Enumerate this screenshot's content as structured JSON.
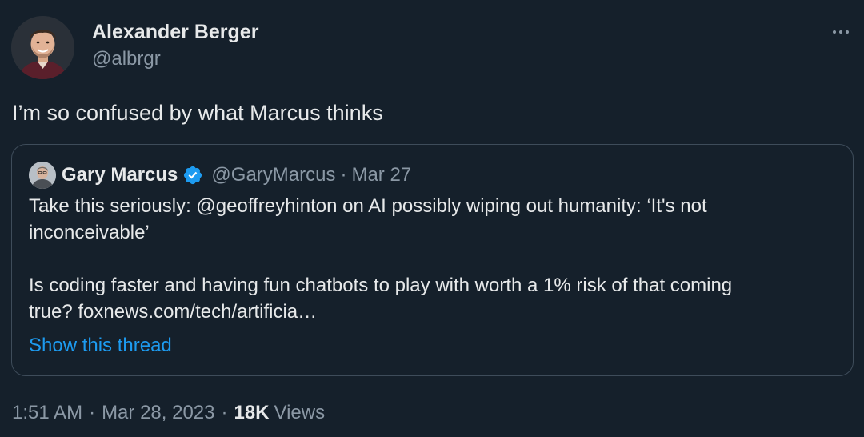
{
  "tweet": {
    "author": {
      "name": "Alexander Berger",
      "handle": "@albrgr"
    },
    "text": "I’m so confused by what Marcus thinks",
    "quote": {
      "author_name": "Gary Marcus",
      "author_handle": "@GaryMarcus",
      "separator": "·",
      "date": "Mar 27",
      "paragraph1_line1": "Take this seriously:  @geoffreyhinton on AI possibly wiping out humanity: ‘It's not",
      "paragraph1_line2": "inconceivable’",
      "paragraph2_line1": "Is coding faster and having fun chatbots to play with worth a 1% risk of that coming",
      "paragraph2_line2": "true? foxnews.com/tech/artificia…",
      "show_thread_label": "Show this thread"
    },
    "meta": {
      "time": "1:51 AM",
      "separator": "·",
      "date": "Mar 28, 2023",
      "views_count": "18K",
      "views_label": "Views"
    }
  },
  "icons": {
    "more": "more-horizontal-icon",
    "verified": "verified-badge-icon"
  },
  "colors": {
    "background": "#15202b",
    "text_primary": "#e7e9ea",
    "text_secondary": "#8b98a5",
    "link": "#1d9bf0",
    "verified": "#1d9bf0",
    "border": "#3e4c5a"
  }
}
